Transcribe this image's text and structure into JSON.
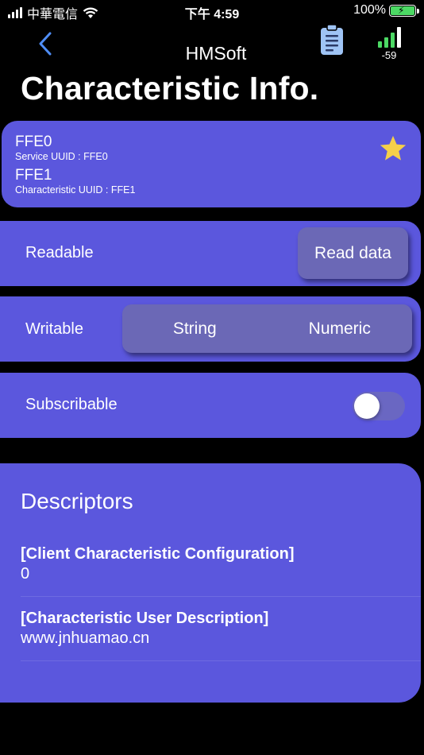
{
  "status_bar": {
    "carrier": "中華電信",
    "time": "下午 4:59",
    "battery": "100%"
  },
  "nav": {
    "title": "HMSoft",
    "rssi": "-59"
  },
  "page_title": "Characteristic Info.",
  "info": {
    "service_name": "FFE0",
    "service_uuid": "Service UUID : FFE0",
    "characteristic_name": "FFE1",
    "characteristic_uuid": "Characteristic UUID : FFE1"
  },
  "readable": {
    "label": "Readable",
    "button": "Read data"
  },
  "writable": {
    "label": "Writable",
    "options": [
      "String",
      "Numeric"
    ]
  },
  "subscribable": {
    "label": "Subscribable",
    "toggle_on": false
  },
  "descriptors": {
    "title": "Descriptors",
    "items": [
      {
        "name": "[Client Characteristic Configuration]",
        "value": "0"
      },
      {
        "name": "[Characteristic User Description]",
        "value": "www.jnhuamao.cn"
      }
    ]
  },
  "colors": {
    "card": "#5b57dd",
    "button": "#6b68b6",
    "star": "#f5d04a",
    "rssi_active": "#4cd964",
    "accent_blue": "#4f8df5"
  }
}
